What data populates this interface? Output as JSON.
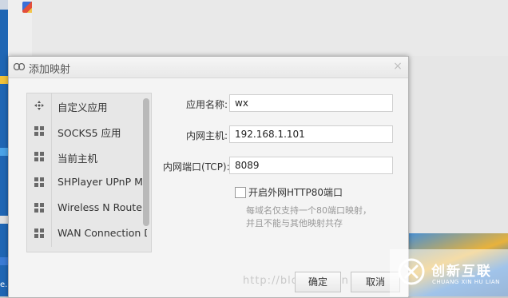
{
  "dialog": {
    "title": "添加映射",
    "close_glyph": "×"
  },
  "sidebar": {
    "items": [
      {
        "label": "自定义应用",
        "icon": "move-icon"
      },
      {
        "label": "SOCKS5 应用",
        "icon": "grid-icon"
      },
      {
        "label": "当前主机",
        "icon": "grid-icon"
      },
      {
        "label": "SHPlayer UPnP Me",
        "icon": "grid-icon"
      },
      {
        "label": "Wireless N Router",
        "icon": "grid-icon"
      },
      {
        "label": "WAN Connection D",
        "icon": "grid-icon"
      }
    ]
  },
  "form": {
    "app_name_label": "应用名称:",
    "app_name_value": "wx",
    "host_label": "内网主机:",
    "host_value": "192.168.1.101",
    "port_label": "内网端口(TCP):",
    "port_value": "8089",
    "http80_label": "开启外网HTTP80端口",
    "http80_checked": false,
    "hint_line1": "每域名仅支持一个80端口映射，",
    "hint_line2": "并且不能与其他映射共存"
  },
  "footer": {
    "watermark": "http://blog.csdn.n",
    "ok_label": "确定",
    "cancel_label": "取消"
  },
  "brand": {
    "name_cn": "创新互联",
    "name_en": "CHUANG XIN HU LIAN"
  },
  "desktop": {
    "left_label": "e."
  },
  "colors": {
    "dialog_bg": "#f4f4f4",
    "sidebar_bg": "#e7e7e7",
    "accent": "#1f66b4"
  }
}
